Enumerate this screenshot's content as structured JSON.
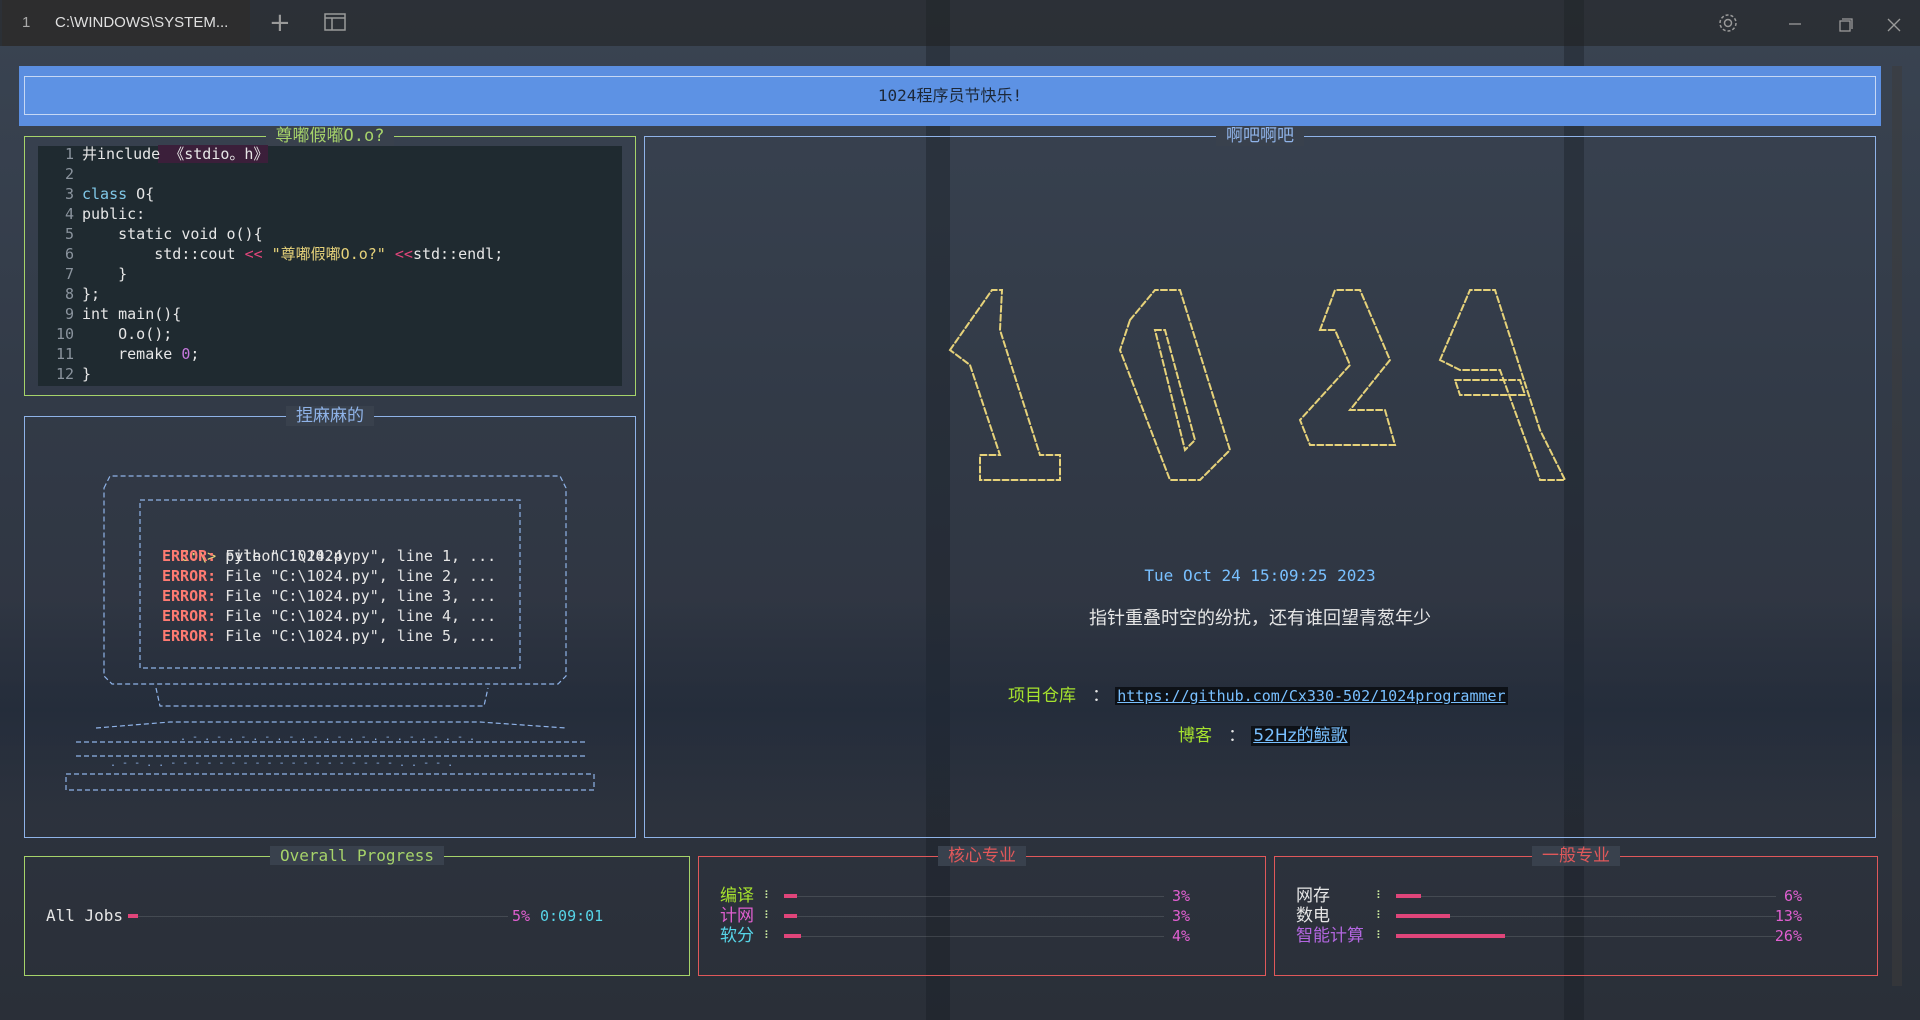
{
  "window": {
    "tab_number": "1",
    "tab_title": "C:\\WINDOWS\\SYSTEM...",
    "icons": [
      "plus-icon",
      "split-icon",
      "gear-icon",
      "minimize-icon",
      "maximize-icon",
      "close-icon"
    ]
  },
  "banner": {
    "text": "1024程序员节快乐!"
  },
  "code_panel": {
    "title": "尊嘟假嘟O.o?",
    "lines": [
      {
        "n": "1",
        "text": "井include 《stdio。h》"
      },
      {
        "n": "2",
        "text": ""
      },
      {
        "n": "3",
        "kw": "class",
        "text": " O{"
      },
      {
        "n": "4",
        "text": "public:"
      },
      {
        "n": "5",
        "text": "    static void o(){"
      },
      {
        "n": "6",
        "pre": "        std::cout ",
        "op1": "<<",
        "str": " \"尊嘟假嘟O.o?\" ",
        "op2": "<<",
        "post": "std::endl;"
      },
      {
        "n": "7",
        "text": "    }"
      },
      {
        "n": "8",
        "text": "};"
      },
      {
        "n": "9",
        "text": "int main(){"
      },
      {
        "n": "10",
        "text": "    O.o();"
      },
      {
        "n": "11",
        "pre": "    remake ",
        "num": "0",
        "post": ";"
      },
      {
        "n": "12",
        "text": "}"
      }
    ]
  },
  "terminal_panel": {
    "title": "捏麻麻的",
    "prompt": "C:\\>",
    "command": " python 1024.py",
    "errors": [
      {
        "label": "ERROR:",
        "msg": " File \"C:\\1024.py\", line 1, ..."
      },
      {
        "label": "ERROR:",
        "msg": " File \"C:\\1024.py\", line 2, ..."
      },
      {
        "label": "ERROR:",
        "msg": " File \"C:\\1024.py\", line 3, ..."
      },
      {
        "label": "ERROR:",
        "msg": " File \"C:\\1024.py\", line 4, ..."
      },
      {
        "label": "ERROR:",
        "msg": " File \"C:\\1024.py\", line 5, ..."
      }
    ]
  },
  "main_panel": {
    "title": "啊吧啊吧",
    "date": "Tue Oct 24 15:09:25 2023",
    "quote": "指针重叠时空的纷扰，还有谁回望青葱年少",
    "repo_label": "项目仓库",
    "repo_sep": " ：",
    "repo_url": "https://github.com/Cx330-502/1024programmer",
    "blog_label": "博客",
    "blog_sep": " ：",
    "blog_name": "52Hz的鲸歌"
  },
  "overall_progress": {
    "title": "Overall Progress",
    "label": "All Jobs",
    "percent": "5%",
    "progress": 0.05,
    "elapsed": "0:09:01"
  },
  "core_panel": {
    "title": "核心专业",
    "items": [
      {
        "name": "编译",
        "percent": "3%",
        "progress": 0.03,
        "color": "#a6e22e"
      },
      {
        "name": "计网",
        "percent": "3%",
        "progress": 0.03,
        "color": "#e05fd0"
      },
      {
        "name": "软分",
        "percent": "4%",
        "progress": 0.04,
        "color": "#57d5e8"
      }
    ]
  },
  "general_panel": {
    "title": "一般专业",
    "items": [
      {
        "name": "网存",
        "percent": "6%",
        "progress": 0.06,
        "color": "#e6e6e6"
      },
      {
        "name": "数电",
        "percent": "13%",
        "progress": 0.13,
        "color": "#e6e6e6"
      },
      {
        "name": "智能计算",
        "percent": "26%",
        "progress": 0.26,
        "color": "#b366e0"
      }
    ]
  },
  "colors": {
    "banner": "#5d92e4",
    "green_border": "#a6d36a",
    "blue_border": "#8fb3e8",
    "red_border": "#e0585a",
    "bar": "#e0457a",
    "accent_cyan": "#57d5e8"
  }
}
